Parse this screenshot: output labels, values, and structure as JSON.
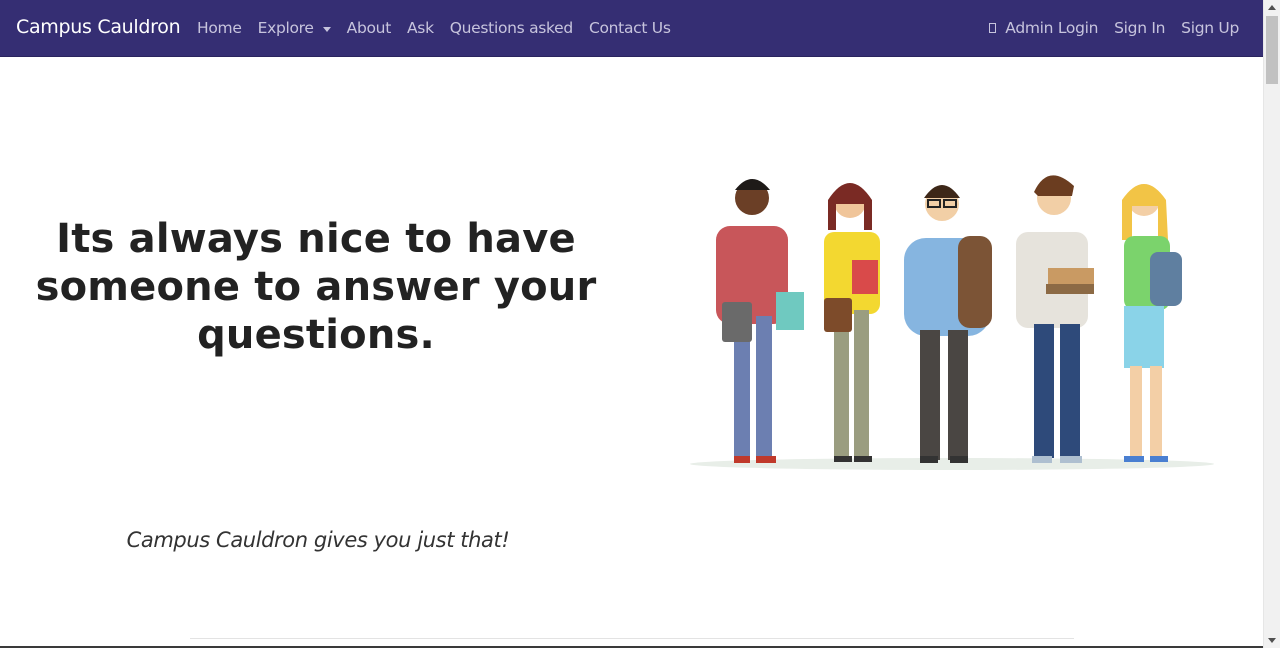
{
  "navbar": {
    "brand": "Campus Cauldron",
    "left_links": [
      "Home",
      "Explore",
      "About",
      "Ask",
      "Questions asked",
      "Contact Us"
    ],
    "right_links": [
      "Admin Login",
      "Sign In",
      "Sign Up"
    ],
    "colors": {
      "background": "#352e73",
      "link": "#c7c4dd",
      "brand": "#ffffff"
    }
  },
  "hero": {
    "headline_line1": "Its always nice to have",
    "headline_line2": "someone to answer your",
    "headline_line3": "questions.",
    "tagline": "Campus Cauldron gives you just that!",
    "illustration": "group-of-students-illustration"
  }
}
